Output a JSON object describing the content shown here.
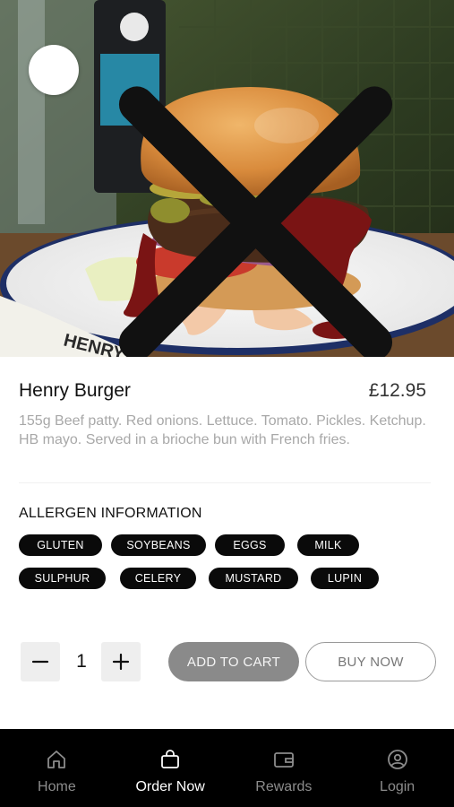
{
  "hero": {
    "close_icon": "close-icon"
  },
  "item": {
    "title": "Henry Burger",
    "price": "£12.95",
    "description": "155g Beef patty. Red onions. Lettuce. Tomato. Pickles. Ketchup. HB mayo. Served in a brioche bun with French fries."
  },
  "allergens": {
    "heading": "ALLERGEN INFORMATION",
    "items": [
      "GLUTEN",
      "SOYBEANS",
      "EGGS",
      "MILK",
      "SULPHUR",
      "CELERY",
      "MUSTARD",
      "LUPIN"
    ]
  },
  "quantity": {
    "value": "1",
    "decrement_icon": "minus-icon",
    "increment_icon": "plus-icon"
  },
  "actions": {
    "add_to_cart": "ADD TO CART",
    "buy_now": "BUY NOW"
  },
  "nav": {
    "items": [
      {
        "label": "Home",
        "icon": "home-icon",
        "active": false
      },
      {
        "label": "Order Now",
        "icon": "bag-icon",
        "active": true
      },
      {
        "label": "Rewards",
        "icon": "wallet-icon",
        "active": false
      },
      {
        "label": "Login",
        "icon": "user-icon",
        "active": false
      }
    ]
  },
  "colors": {
    "accent": "#000000",
    "chip_bg": "#0a0a0a",
    "add_to_cart_bg": "#8a8a8a",
    "muted_text": "#a8a8a8"
  }
}
